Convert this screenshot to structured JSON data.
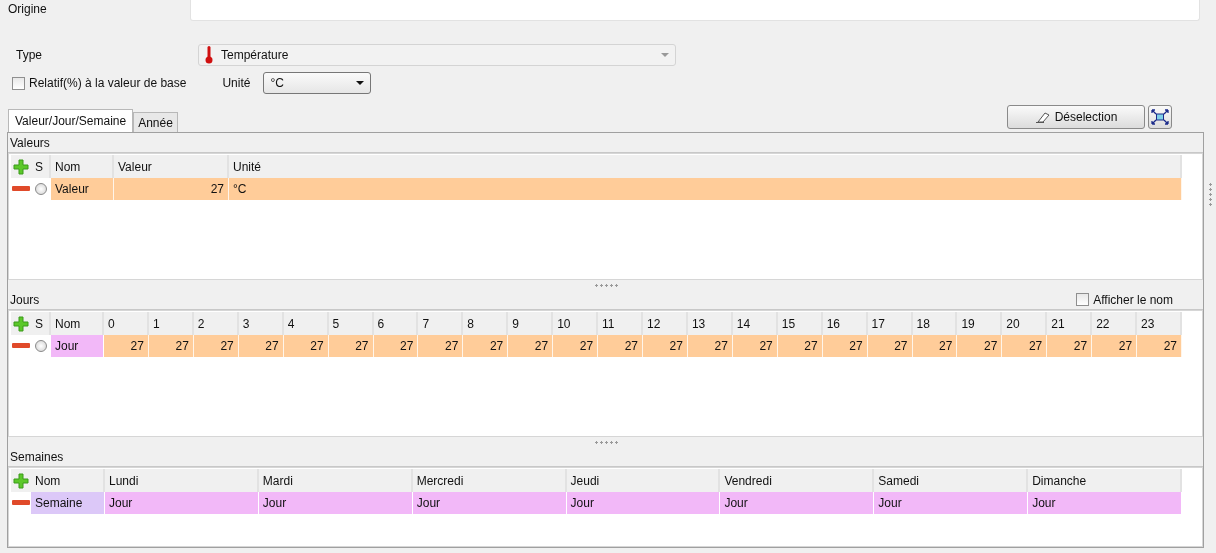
{
  "origin": {
    "label": "Origine"
  },
  "type": {
    "label": "Type",
    "value": "Température",
    "disabled": true
  },
  "relative": {
    "label": "Relatif(%) à la valeur de base",
    "checked": false
  },
  "unit": {
    "label": "Unité",
    "value": "°C"
  },
  "tabs": [
    {
      "label": "Valeur/Jour/Semaine",
      "selected": true
    },
    {
      "label": "Année",
      "selected": false
    }
  ],
  "deselect_button": "Déselection",
  "values_section": {
    "title": "Valeurs",
    "columns": [
      "S",
      "Nom",
      "Valeur",
      "Unité"
    ],
    "rows": [
      {
        "selected": false,
        "name": "Valeur",
        "value": "27",
        "unit": "°C"
      }
    ]
  },
  "days_section": {
    "title": "Jours",
    "show_name": {
      "label": "Afficher le nom",
      "checked": false
    },
    "columns": [
      "S",
      "Nom",
      "0",
      "1",
      "2",
      "3",
      "4",
      "5",
      "6",
      "7",
      "8",
      "9",
      "10",
      "11",
      "12",
      "13",
      "14",
      "15",
      "16",
      "17",
      "18",
      "19",
      "20",
      "21",
      "22",
      "23"
    ],
    "rows": [
      {
        "selected": false,
        "name": "Jour",
        "values": [
          "27",
          "27",
          "27",
          "27",
          "27",
          "27",
          "27",
          "27",
          "27",
          "27",
          "27",
          "27",
          "27",
          "27",
          "27",
          "27",
          "27",
          "27",
          "27",
          "27",
          "27",
          "27",
          "27",
          "27"
        ]
      }
    ]
  },
  "weeks_section": {
    "title": "Semaines",
    "columns": [
      "Nom",
      "Lundi",
      "Mardi",
      "Mercredi",
      "Jeudi",
      "Vendredi",
      "Samedi",
      "Dimanche"
    ],
    "rows": [
      {
        "name": "Semaine",
        "days": [
          "Jour",
          "Jour",
          "Jour",
          "Jour",
          "Jour",
          "Jour",
          "Jour"
        ]
      }
    ]
  }
}
